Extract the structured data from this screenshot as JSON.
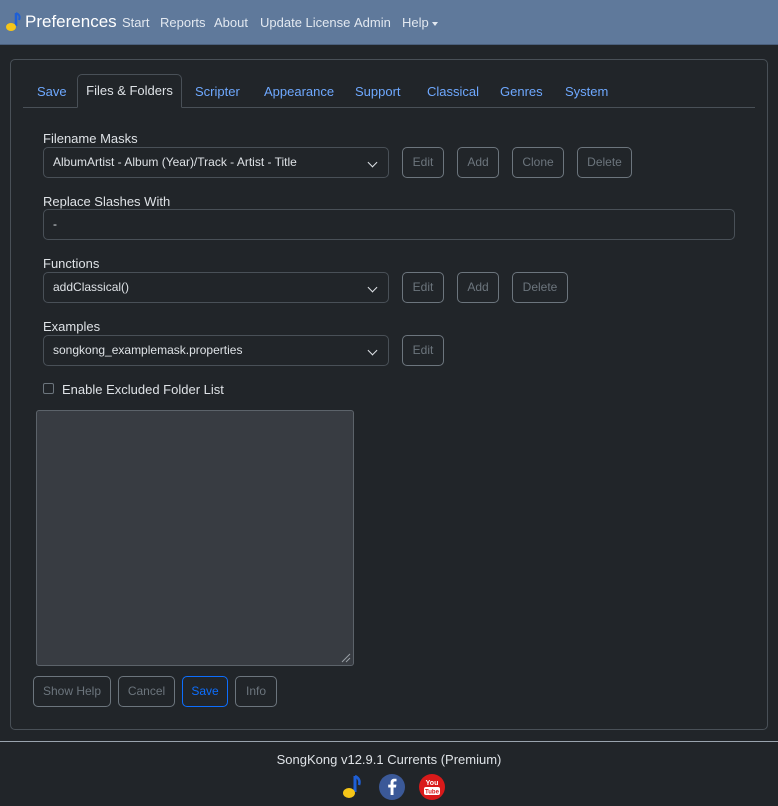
{
  "navbar": {
    "brand": "Preferences",
    "links": [
      "Start",
      "Reports",
      "About",
      "Update License",
      "Admin",
      "Help"
    ]
  },
  "tabs": [
    "Save",
    "Files & Folders",
    "Scripter",
    "Appearance",
    "Support",
    "Classical",
    "Genres",
    "System"
  ],
  "form": {
    "filename_masks": {
      "label": "Filename Masks",
      "value": "AlbumArtist - Album (Year)/Track - Artist - Title",
      "buttons": [
        "Edit",
        "Add",
        "Clone",
        "Delete"
      ]
    },
    "replace_slashes": {
      "label": "Replace Slashes With",
      "value": "-"
    },
    "functions": {
      "label": "Functions",
      "value": "addClassical()",
      "buttons": [
        "Edit",
        "Add",
        "Delete"
      ]
    },
    "examples": {
      "label": "Examples",
      "value": "songkong_examplemask.properties",
      "buttons": [
        "Edit"
      ]
    },
    "excluded": {
      "label": "Enable Excluded Folder List",
      "checked": false
    }
  },
  "actions": [
    "Show Help",
    "Cancel",
    "Save",
    "Info"
  ],
  "footer": {
    "version": "SongKong v12.9.1 Currents (Premium)"
  },
  "colors": {
    "navbar": "#5f799b",
    "background": "#212529",
    "link": "#6ea8fe",
    "primary": "#0d6efd",
    "facebook": "#3b5998",
    "youtube": "#d91a1a"
  }
}
